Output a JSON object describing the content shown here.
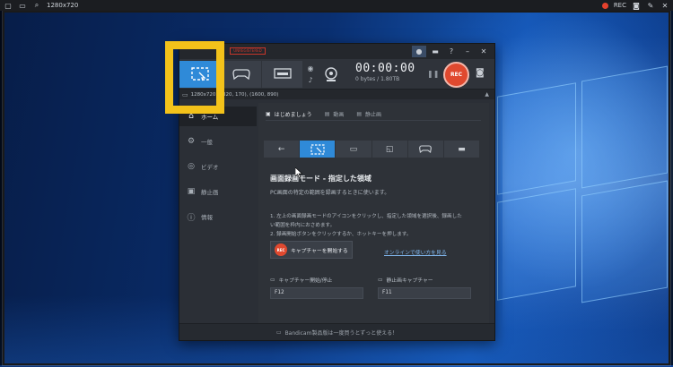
{
  "region_bar": {
    "resolution": "1280x720",
    "rec_label": "REC"
  },
  "app": {
    "timer": "00:00:00",
    "bytes": "0 bytes / 1.80TB",
    "rec_button": "REC",
    "info_text": "1280x720 - (320, 170), (1600, 890)",
    "sidebar": [
      {
        "label": "ホーム",
        "icon": "home-icon"
      },
      {
        "label": "一般",
        "icon": "gear-icon"
      },
      {
        "label": "ビデオ",
        "icon": "video-icon"
      },
      {
        "label": "静止画",
        "icon": "image-icon"
      },
      {
        "label": "情報",
        "icon": "info-icon"
      }
    ],
    "subtabs": [
      {
        "label": "はじめましょう"
      },
      {
        "label": "動画"
      },
      {
        "label": "静止画"
      }
    ],
    "mode_title": "画面録画モード - 指定した領域",
    "mode_desc": "PC画面の特定の範囲を録画するときに使います。",
    "step1": "1. 左上の画面録画モードのアイコンをクリックし、指定した領域を選択後、録画した",
    "step1b": "い範囲を枠内におさめます。",
    "step2": "2. 録画開始ボタンをクリックするか、ホットキーを押します。",
    "start_button": "キャプチャーを開始する",
    "help_link": "オンラインで使い方を見る",
    "hotkeys": [
      {
        "label": "キャプチャー開始/停止",
        "value": "F12"
      },
      {
        "label": "静止画キャプチャー",
        "value": "F11"
      }
    ],
    "footer": "Bandicam製品版は一度買うとずっと使える！"
  },
  "colors": {
    "accent_blue": "#2f8ad8",
    "rec_red": "#e0492f",
    "highlight_yellow": "#f3c21a"
  }
}
